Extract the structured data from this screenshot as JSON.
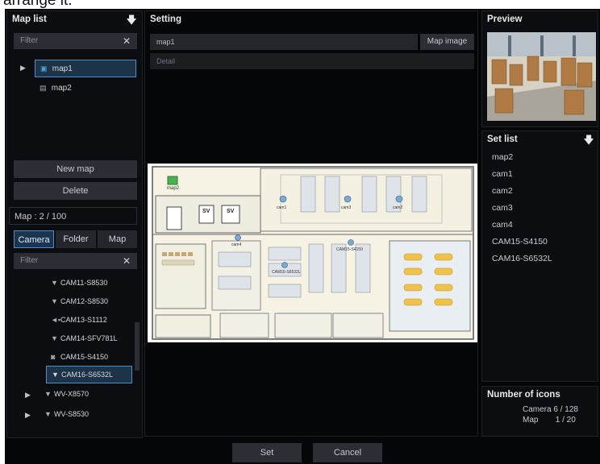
{
  "caption": "arrange it.",
  "map_list": {
    "title": "Map list",
    "filter_placeholder": "Filter",
    "items": [
      {
        "label": "map1",
        "selected": true
      },
      {
        "label": "map2",
        "selected": false
      }
    ],
    "new_map_label": "New map",
    "delete_label": "Delete",
    "map_count": "Map : 2 / 100"
  },
  "tabs": [
    "Camera",
    "Folder",
    "Map"
  ],
  "camera_filter_placeholder": "Filter",
  "camera_tree": [
    {
      "label": "CAM11-S8530",
      "icon": "dome-camera-icon"
    },
    {
      "label": "CAM12-S8530",
      "icon": "dome-camera-icon"
    },
    {
      "label": "CAM13-S1112",
      "icon": "box-camera-icon"
    },
    {
      "label": "CAM14-SFV781L",
      "icon": "dome-camera-icon"
    },
    {
      "label": "CAM15-S4150",
      "icon": "ptz-camera-icon"
    },
    {
      "label": "CAM16-S6532L",
      "icon": "dome-camera-icon",
      "selected": true
    },
    {
      "label": "WV-X8570",
      "icon": "dome-camera-icon",
      "group": true
    },
    {
      "label": "WV-S8530",
      "icon": "dome-camera-icon",
      "group": true
    }
  ],
  "setting": {
    "title": "Setting",
    "name_value": "map1",
    "map_image_label": "Map image",
    "detail_placeholder": "Detail"
  },
  "preview": {
    "title": "Preview"
  },
  "set_list": {
    "title": "Set list",
    "items": [
      "map2",
      "cam1",
      "cam2",
      "cam3",
      "cam4",
      "CAM15-S4150",
      "CAM16-S6532L"
    ]
  },
  "icon_counts": {
    "title": "Number of icons",
    "camera_label": "Camera",
    "camera_value": "6 / 128",
    "map_label": "Map",
    "map_value": "1 / 20"
  },
  "floor_labels": {
    "map_tag": "map2",
    "sv1": "SV",
    "sv2": "SV",
    "cams": [
      "cam1",
      "cam3",
      "cam2",
      "CAM15-S4150",
      "CAM16-S6532L",
      "cam4"
    ]
  },
  "footer": {
    "set_label": "Set",
    "cancel_label": "Cancel"
  },
  "colors": {
    "accent": "#4c8ec5",
    "panel": "#0b0d10",
    "button": "#2b2e34"
  }
}
